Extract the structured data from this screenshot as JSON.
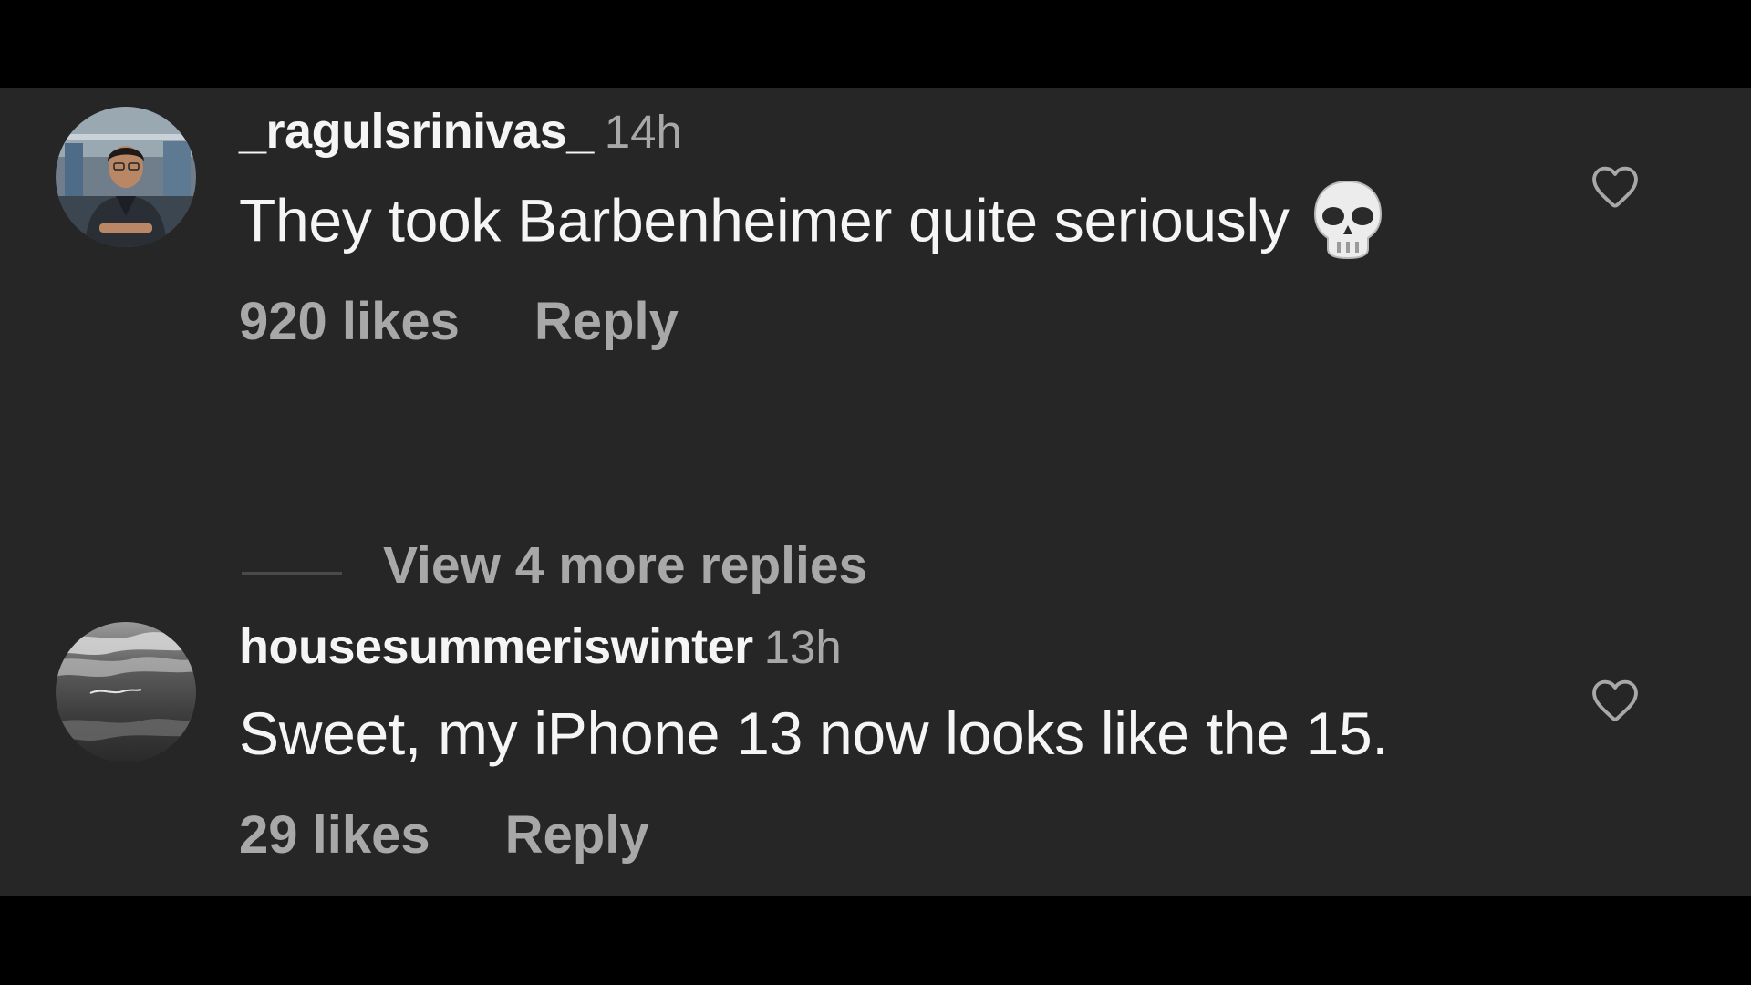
{
  "comments": [
    {
      "username": "_ragulsrinivas_",
      "time": "14h",
      "text": "They took Barbenheimer quite seriously",
      "emoji": "skull-emoji",
      "likes": "920 likes",
      "reply": "Reply",
      "avatar": "profile-photo-man"
    },
    {
      "username": "housesummeriswinter",
      "time": "13h",
      "text": "Sweet, my iPhone 13 now looks like the 15.",
      "likes": "29 likes",
      "reply": "Reply",
      "avatar": "grey-clouds-photo"
    }
  ],
  "view_more_replies": "View 4 more replies",
  "icons": {
    "like": "heart-outline-icon"
  },
  "colors": {
    "panel_bg": "#262626",
    "outer_bg": "#000000",
    "primary_text": "#f5f5f5",
    "secondary_text": "#a8a8a8"
  }
}
